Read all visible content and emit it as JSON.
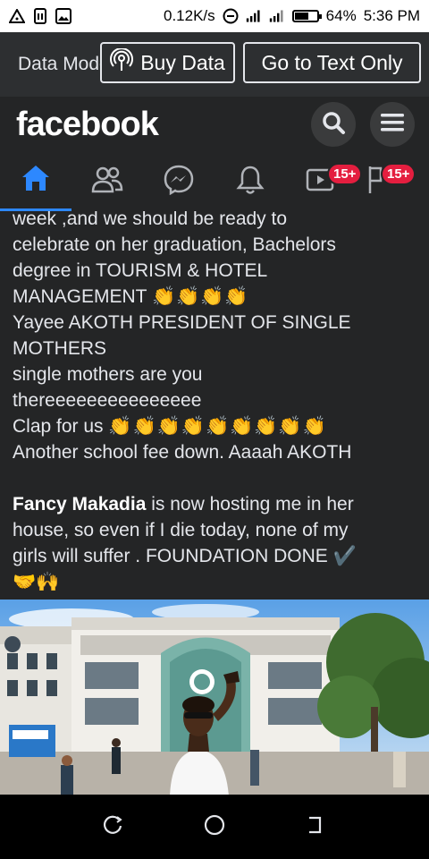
{
  "status_bar": {
    "speed": "0.12K/s",
    "battery": "64%",
    "battery_level": 0.64,
    "time": "5:36 PM",
    "left_icons": [
      "notification-icon",
      "sim-icon",
      "image-icon"
    ],
    "right_icons": [
      "dnd-icon",
      "signal-icon",
      "signal-icon",
      "battery-icon"
    ]
  },
  "data_banner": {
    "mode_label": "Data Mode",
    "buy_data_label": "Buy Data",
    "text_only_label": "Go to Text Only"
  },
  "header": {
    "logo": "facebook"
  },
  "tabs": [
    {
      "name": "home",
      "icon": "home-icon",
      "active": true
    },
    {
      "name": "friends",
      "icon": "friends-icon"
    },
    {
      "name": "messenger",
      "icon": "messenger-icon"
    },
    {
      "name": "notifications",
      "icon": "bell-icon"
    },
    {
      "name": "watch",
      "icon": "video-icon",
      "badge": "15+"
    },
    {
      "name": "pages",
      "icon": "flag-icon",
      "badge": "15+"
    }
  ],
  "post": {
    "line_partial": "week ,and we should be ready to",
    "line_2": "celebrate on her graduation,  Bachelors",
    "line_3": "degree in TOURISM & HOTEL",
    "line_4": "MANAGEMENT",
    "line_4_emoji": "👏👏👏👏",
    "line_5": "Yayee AKOTH PRESIDENT OF SINGLE",
    "line_6": "MOTHERS",
    "line_7": "single mothers are you",
    "line_8": "thereeeeeeeeeeeeeee",
    "line_9": "Clap for us",
    "line_9_emoji": "👏👏👏👏👏👏👏👏👏",
    "line_10": "Another school fee down. Aaaah AKOTH",
    "mention": "Fancy Makadia",
    "line_11_rest": " is now hosting me in her",
    "line_12": "house, so even if I die today, none of my",
    "line_13": "girls will suffer . FOUNDATION DONE ✔️",
    "line_14_emoji": "🤝🙌"
  },
  "nav_bar": {
    "icons": [
      "recents-icon",
      "home-circle-icon",
      "back-icon"
    ]
  }
}
